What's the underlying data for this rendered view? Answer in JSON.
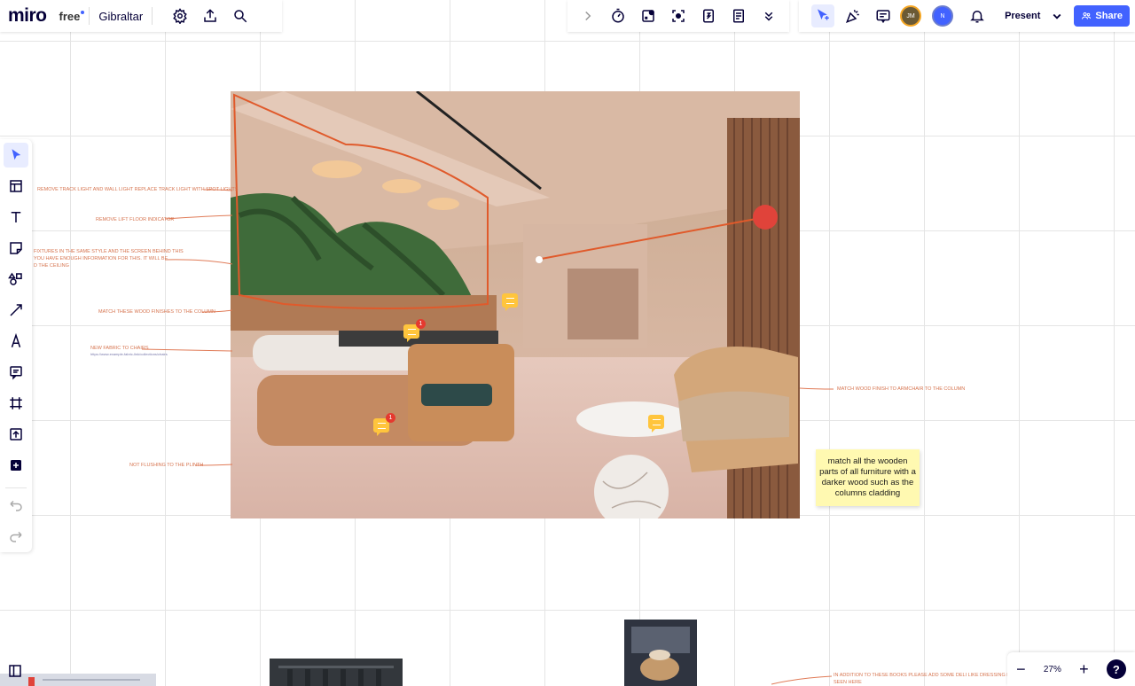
{
  "app": {
    "logo": "miro",
    "plan": "free",
    "board_name": "Gibraltar"
  },
  "header": {
    "left_icons": [
      "settings-icon",
      "upload-icon",
      "search-icon"
    ],
    "right_tools": [
      "collapse-chevron-icon",
      "timer-icon",
      "activity-icon",
      "focus-icon",
      "count-icon",
      "notes-icon",
      "more-chevron-icon"
    ],
    "collab_tools": [
      "cursor-icon",
      "reactions-icon",
      "comments-panel-icon"
    ],
    "avatars": [
      {
        "initials": "JM",
        "color": "#6b5a35"
      },
      {
        "initials": "N",
        "color": "#4262ff"
      }
    ],
    "present_label": "Present",
    "share_label": "Share"
  },
  "left_toolbar": [
    "select-icon",
    "templates-icon",
    "text-icon",
    "sticky-note-icon",
    "shapes-icon",
    "connector-icon",
    "pen-icon",
    "comment-icon",
    "frame-icon",
    "upload-icon",
    "add-icon",
    "undo-icon",
    "redo-icon"
  ],
  "annotations": [
    {
      "text": "REMOVE TRACK LIGHT AND WALL LIGHT REPLACE TRACK LIGHT WITH SPOT LIGHTS"
    },
    {
      "text": "REMOVE LIFT FLOOR INDICATOR"
    },
    {
      "text": "FIXTURES IN THE SAME STYLE AND THE SCREEN BEHIND THIS"
    },
    {
      "text": "YOU HAVE ENOUGH INFORMATION FOR THIS. IT WILL BE"
    },
    {
      "text": "D THE CEILING"
    },
    {
      "text": "MATCH THESE WOOD FINISHES TO THE COLUMN"
    },
    {
      "text": "NEW FABRIC TO CHAIRS"
    },
    {
      "text": "https://www.example-fabric-link/collections/chairs"
    },
    {
      "text": "NOT FLUSHING TO THE PLINTH"
    },
    {
      "text": "MATCH WOOD FINISH TO ARMCHAIR TO THE COLUMN"
    },
    {
      "text": "IN ADDITION TO THESE BOOKS PLEASE ADD SOME DELI LIKE DRESSING LIKE THE"
    },
    {
      "text": "SEEN HERE"
    }
  ],
  "sticky_note": {
    "text": "match all the wooden parts of all furniture with a darker wood such as the  columns cladding"
  },
  "comments": [
    {
      "badge": "1"
    },
    {
      "badge": "1"
    }
  ],
  "zoom": {
    "level": "27%",
    "minus": "−",
    "plus": "+",
    "help": "?"
  }
}
